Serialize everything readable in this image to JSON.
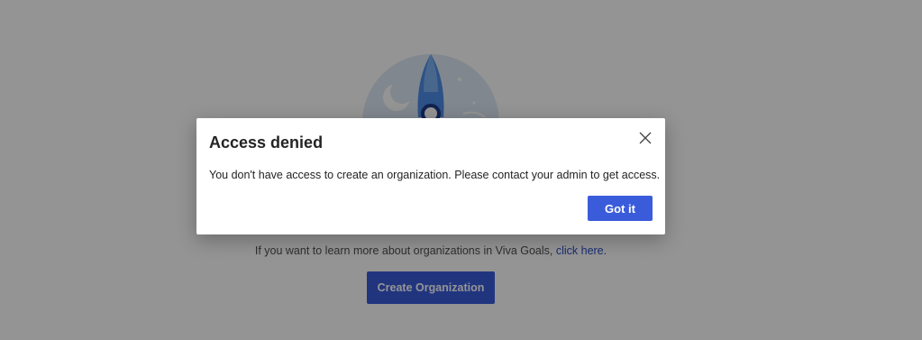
{
  "background": {
    "learn_more_text": "If you want to learn more about organizations in Viva Goals, ",
    "learn_more_link": "click here.",
    "create_button_label": "Create Organization"
  },
  "dialog": {
    "title": "Access denied",
    "message": "You don't have access to create an organization. Please contact your admin to get access.",
    "confirm_label": "Got it",
    "close_icon": "close-icon"
  },
  "colors": {
    "accent": "#3a5cdb",
    "link": "#2b4fc4",
    "overlay": "rgba(0,0,0,0.42)"
  }
}
